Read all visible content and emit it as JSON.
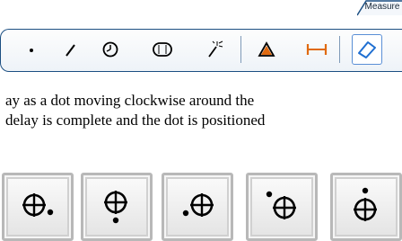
{
  "toolbar": {
    "tab_label": "Measure",
    "tools": [
      {
        "name": "point-tool",
        "icon": "dot-icon"
      },
      {
        "name": "line-tool",
        "icon": "line-icon"
      },
      {
        "name": "circle-tool",
        "icon": "circle-icon"
      },
      {
        "name": "slot-tool",
        "icon": "slot-icon"
      },
      {
        "name": "magic-wand-tool",
        "icon": "magic-wand-icon"
      },
      {
        "name": "angle-tool",
        "icon": "angle-icon"
      },
      {
        "name": "distance-tool",
        "icon": "distance-icon"
      },
      {
        "name": "erase-tool",
        "icon": "eraser-icon"
      }
    ],
    "accent_color": "#1c4f82",
    "angle_icon_color": "#e06a10"
  },
  "text": {
    "line1": "ay as a dot moving clockwise around the",
    "line2": "delay is complete and the dot is positioned"
  },
  "frames": [
    {
      "icon": "crosshair-dot-right-icon",
      "dot_position": "right"
    },
    {
      "icon": "crosshair-dot-bottom-icon",
      "dot_position": "bottom"
    },
    {
      "icon": "crosshair-dot-left-icon",
      "dot_position": "left"
    },
    {
      "icon": "crosshair-dot-top-left-icon",
      "dot_position": "top-left"
    },
    {
      "icon": "crosshair-dot-top-icon",
      "dot_position": "top"
    }
  ]
}
